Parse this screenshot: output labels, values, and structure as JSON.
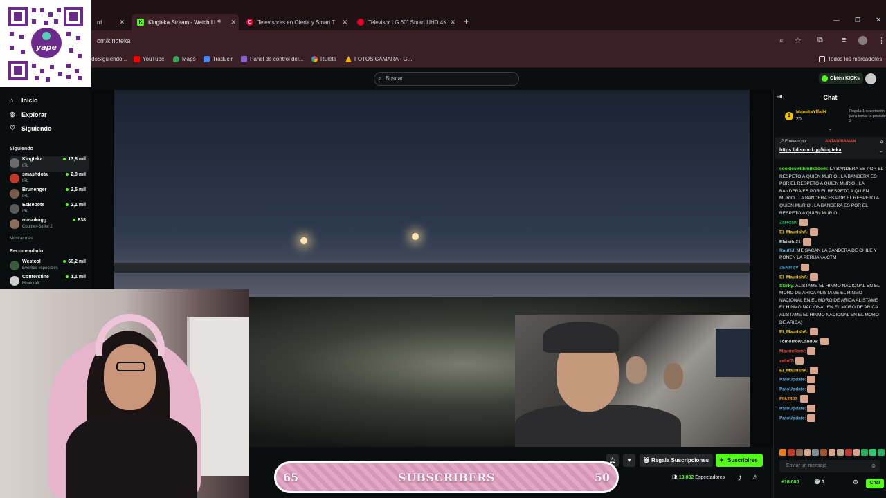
{
  "browser": {
    "tabs": [
      {
        "label": "rd",
        "favicon_color": "#333"
      },
      {
        "label": "Kingteka Stream - Watch Li",
        "favicon_color": "#53fc18",
        "favicon_letter": "K"
      },
      {
        "label": "Televisores en Oferta y Smart T",
        "favicon_color": "#e4002b",
        "favicon_letter": "C"
      },
      {
        "label": "Televisor LG 60\" Smart UHD 4K",
        "favicon_color": "#e4002b",
        "favicon_letter": ""
      }
    ],
    "url": "om/kingteka",
    "bookmarks": [
      {
        "label": "doSiguiendo...",
        "color": "#666"
      },
      {
        "label": "YouTube",
        "color": "#ff0000"
      },
      {
        "label": "Maps",
        "color": "#34a853"
      },
      {
        "label": "Traducir",
        "color": "#4285f4"
      },
      {
        "label": "Panel de control del...",
        "color": "#8a63d2"
      },
      {
        "label": "Ruleta",
        "color": "#fbbc05"
      },
      {
        "label": "FOTOS CÁMARA - G...",
        "color": "#f4b400"
      }
    ],
    "all_bookmarks": "Todos los marcadores"
  },
  "header": {
    "search_placeholder": "Buscar",
    "kicks_button": "Obtén KICKs"
  },
  "sidebar": {
    "nav": [
      {
        "label": "Inicio",
        "icon": "home-icon"
      },
      {
        "label": "Explorar",
        "icon": "compass-icon"
      },
      {
        "label": "Siguiendo",
        "icon": "heart-icon"
      }
    ],
    "following_title": "Siguiendo",
    "following": [
      {
        "name": "Kingteka",
        "category": "IRL",
        "viewers": "13,8 mil",
        "color": "#6b6b6b"
      },
      {
        "name": "smashdota",
        "category": "IRL",
        "viewers": "2,8 mil",
        "color": "#c0392b"
      },
      {
        "name": "Brunenger",
        "category": "IRL",
        "viewers": "2,5 mil",
        "color": "#7a5a4a"
      },
      {
        "name": "EsBebote",
        "category": "IRL",
        "viewers": "2,1 mil",
        "color": "#5a5a5a"
      },
      {
        "name": "masokugg",
        "category": "Counter-Strike 2",
        "viewers": "838",
        "color": "#8a6d5a"
      }
    ],
    "show_more": "Mostrar más",
    "recommended_title": "Recomendado",
    "recommended": [
      {
        "name": "Westcol",
        "category": "Eventos especiales",
        "viewers": "68,2 mil",
        "color": "#3a5a3a"
      },
      {
        "name": "Conterstine",
        "category": "Minecraft",
        "viewers": "1,1 mil",
        "color": "#cfcfcf"
      }
    ]
  },
  "stream": {
    "goal": {
      "current": "65",
      "label": "SUBSCRIBERS",
      "target": "50"
    },
    "gift_button": "Regala Suscripciones",
    "subscribe_button": "Suscribirse",
    "viewers": "13.832",
    "viewers_label": "Espectadores"
  },
  "chat": {
    "title": "Chat",
    "gifter": {
      "name": "MamitaYlfaiH",
      "count": "20",
      "note": "Regala 1 suscripción para tomar la posición 2"
    },
    "pinned": {
      "prefix": "Enviado por",
      "author": "ANTAURIAMAN",
      "link": "https://discord.gg/kingteka"
    },
    "messages": [
      {
        "user": "cookieswithmilkboom",
        "color": "#53fc18",
        "text": "LA BANDERA ES POR EL RESPETO A QUIEN MURIO . LA BANDERA ES POR EL RESPETO A QUIEN MURIO . LA BANDERA ES POR EL RESPETO A QUIEN MURIO . LA BANDERA ES POR EL RESPETO A QUIEN MURIO . LA BANDERA ES POR EL RESPETO A QUIEN MURIO .",
        "emote": false
      },
      {
        "user": "Zarezan",
        "color": "#2ecc71",
        "text": "",
        "emote": true
      },
      {
        "user": "El_MaurishA",
        "color": "#f1c40f",
        "text": "",
        "emote": true
      },
      {
        "user": "Elvisito21",
        "color": "#dddddd",
        "text": "",
        "emote": true
      },
      {
        "user": "Raul'iJ",
        "color": "#5dade2",
        "text": "ME SACAN LA BANDERA DE CHILE Y PONEN LA PERUANA CTM",
        "emote": false
      },
      {
        "user": "ZENITZV",
        "color": "#5dade2",
        "text": "",
        "emote": true
      },
      {
        "user": "El_MaurishA",
        "color": "#f1c40f",
        "text": "",
        "emote": true
      },
      {
        "user": "Slarky",
        "color": "#53fc18",
        "text": "ALISTAME EL HINMO NACIONAL EN EL MORO DE ARICA ALISTAME EL HINMO NACIONAL EN EL MORO DE ARICA ALISTAME EL HINMO NACIONAL EN EL MORO DE ARICA ALISTAME EL HINMO NACIONAL EN EL MORO DE ARICA)",
        "emote": false
      },
      {
        "user": "El_MaurishA",
        "color": "#f1c40f",
        "text": "",
        "emote": true
      },
      {
        "user": "TomorrowLand09",
        "color": "#dddddd",
        "text": "",
        "emote": true
      },
      {
        "user": "Maurielloml",
        "color": "#e74c3c",
        "text": "",
        "emote": true
      },
      {
        "user": "zeliel7",
        "color": "#e74c3c",
        "text": "",
        "emote": true
      },
      {
        "user": "El_MaurishA",
        "color": "#f1c40f",
        "text": "",
        "emote": true
      },
      {
        "user": "PatoUpdate",
        "color": "#5dade2",
        "text": "",
        "emote": true
      },
      {
        "user": "PatoUpdate",
        "color": "#5dade2",
        "text": "",
        "emote": true
      },
      {
        "user": "Flik2307",
        "color": "#f39c12",
        "text": "",
        "emote": true
      },
      {
        "user": "PatoUpdate",
        "color": "#5dade2",
        "text": "",
        "emote": true
      },
      {
        "user": "PatoUpdate",
        "color": "#5dade2",
        "text": "",
        "emote": true
      }
    ],
    "input_placeholder": "Enviar un mensaje",
    "kicks_balance": "16.080",
    "gift_count": "0",
    "chat_button": "Chat"
  },
  "colors": {
    "accent": "#53fc18",
    "background": "#0b0e0f",
    "goal_pink": "#e2a8c6"
  }
}
